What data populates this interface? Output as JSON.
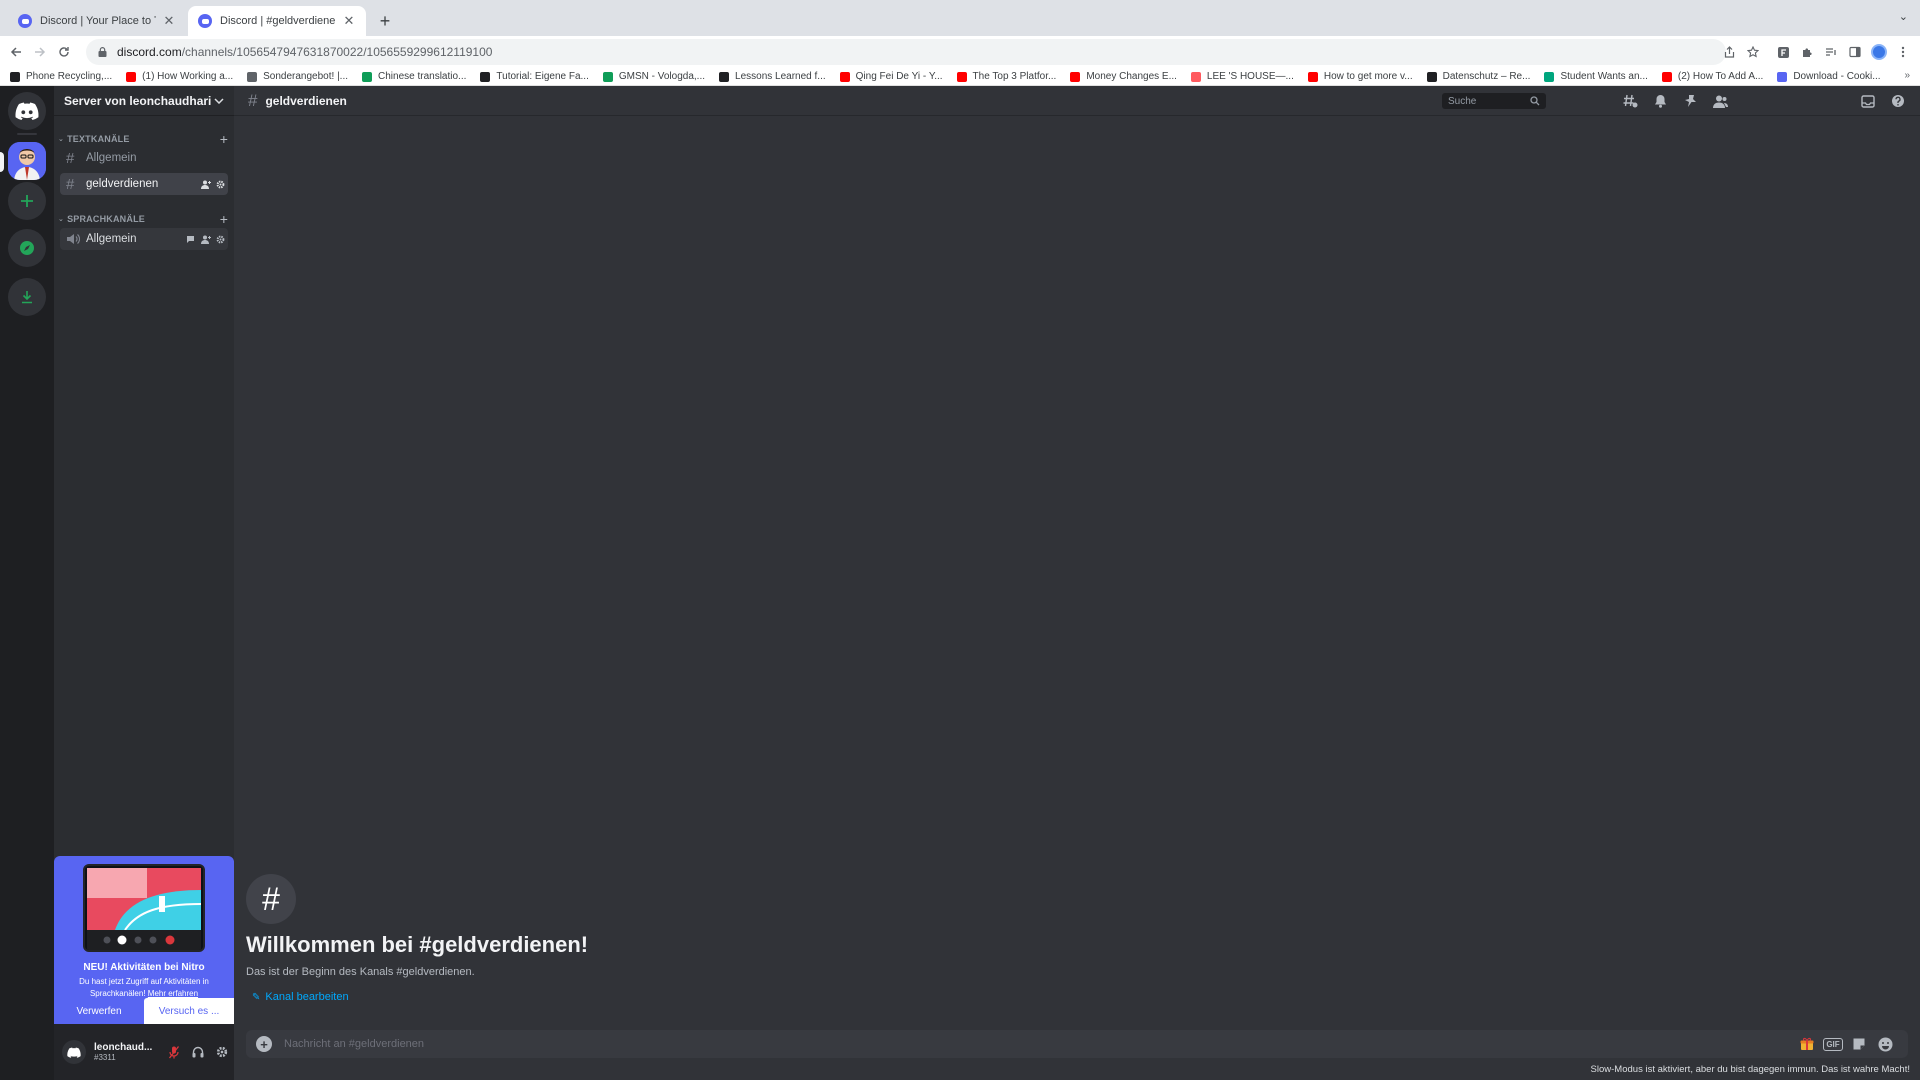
{
  "browser": {
    "tabs": [
      {
        "title": "Discord | Your Place to Talk and Hang Out",
        "active": false
      },
      {
        "title": "Discord | #geldverdienen | Server von leonchaudhari",
        "active": true
      }
    ],
    "url_host": "discord.com",
    "url_path": "/channels/1056547947631870022/1056559299612119100",
    "bookmarks": [
      {
        "label": "Phone Recycling,...",
        "color": "#202124"
      },
      {
        "label": "(1) How Working a...",
        "color": "#ff0000"
      },
      {
        "label": "Sonderangebot! |...",
        "color": "#5f6368"
      },
      {
        "label": "Chinese translatio...",
        "color": "#0f9d58"
      },
      {
        "label": "Tutorial: Eigene Fa...",
        "color": "#202124"
      },
      {
        "label": "GMSN - Vologda,...",
        "color": "#0f9d58"
      },
      {
        "label": "Lessons Learned f...",
        "color": "#202124"
      },
      {
        "label": "Qing Fei De Yi - Y...",
        "color": "#ff0000"
      },
      {
        "label": "The Top 3 Platfor...",
        "color": "#ff0000"
      },
      {
        "label": "Money Changes E...",
        "color": "#ff0000"
      },
      {
        "label": "LEE 'S HOUSE—...",
        "color": "#ff5a5f"
      },
      {
        "label": "How to get more v...",
        "color": "#ff0000"
      },
      {
        "label": "Datenschutz – Re...",
        "color": "#202124"
      },
      {
        "label": "Student Wants an...",
        "color": "#00a67e"
      },
      {
        "label": "(2) How To Add A...",
        "color": "#ff0000"
      },
      {
        "label": "Download - Cooki...",
        "color": "#5865f2"
      }
    ]
  },
  "sidebar": {
    "server_name": "Server von leonchaudhari",
    "text_category": "TEXTKANÄLE",
    "voice_category": "SPRACHKANÄLE",
    "text_channels": [
      {
        "name": "Allgemein",
        "selected": false
      },
      {
        "name": "geldverdienen",
        "selected": true
      }
    ],
    "voice_channels": [
      {
        "name": "Allgemein"
      }
    ]
  },
  "nitro_promo": {
    "title": "NEU! Aktivitäten bei Nitro",
    "text": "Du hast jetzt Zugriff auf Aktivitäten in Sprachkanälen!",
    "link": "Mehr erfahren",
    "dismiss": "Verwerfen",
    "try": "Versuch es ..."
  },
  "user": {
    "name": "leonchaud...",
    "tag": "#3311"
  },
  "channel": {
    "name": "geldverdienen",
    "search_placeholder": "Suche",
    "welcome_title": "Willkommen bei #geldverdienen!",
    "welcome_sub": "Das ist der Beginn des Kanals #geldverdienen.",
    "edit_link": "Kanal bearbeiten",
    "message_placeholder": "Nachricht an #geldverdienen",
    "gif_label": "GIF",
    "slowmode_notice": "Slow-Modus ist aktiviert, aber du bist dagegen immun. Das ist wahre Macht!"
  },
  "colors": {
    "brand": "#5865f2",
    "link": "#00a8fc",
    "green": "#23a559"
  }
}
